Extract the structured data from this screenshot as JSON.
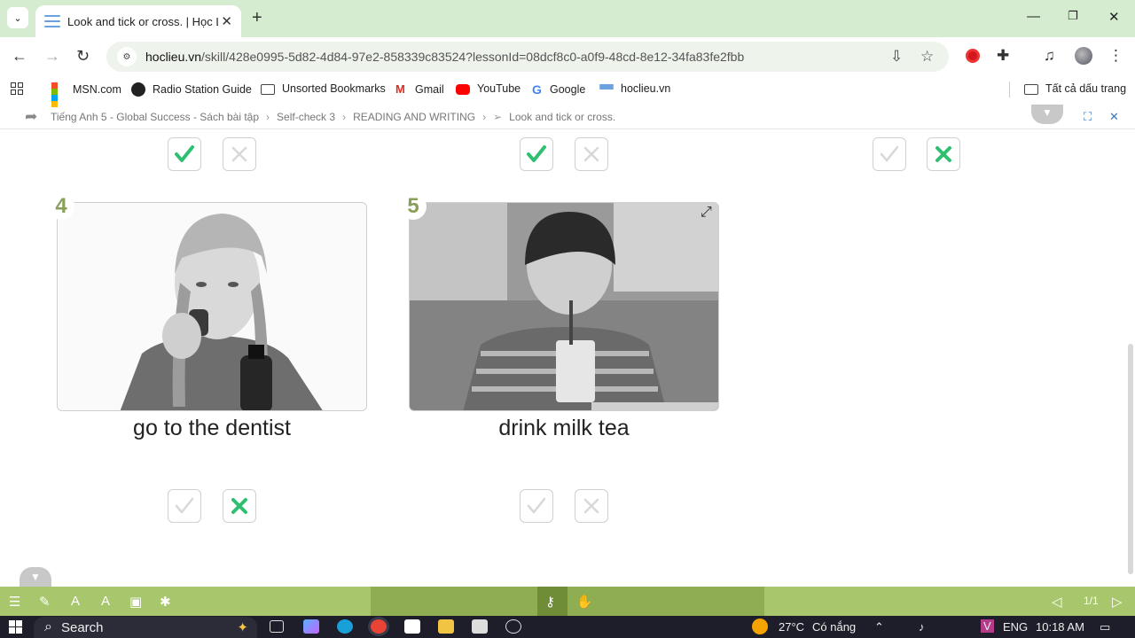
{
  "browser": {
    "tab_title": "Look and tick or cross. | Học Liệ",
    "url_host": "hoclieu.vn",
    "url_path": "/skill/428e0995-5d82-4d84-97e2-858339c83524?lessonId=08dcf8c0-a0f9-48cd-8e12-34fa83fe2fbb"
  },
  "bookmarks": {
    "items": [
      "MSN.com",
      "Radio Station Guide",
      "Unsorted Bookmarks",
      "Gmail",
      "YouTube",
      "Google",
      "hoclieu.vn"
    ],
    "all_bookmarks": "Tất cả dấu trang"
  },
  "breadcrumb": [
    "Tiếng Anh 5 - Global Success - Sách bài tập",
    "Self-check 3",
    "READING AND WRITING",
    "Look and tick or cross."
  ],
  "exercise": {
    "top_row": [
      {
        "tick": "selected",
        "cross": "empty"
      },
      {
        "tick": "selected",
        "cross": "empty"
      },
      {
        "tick": "empty",
        "cross": "selected"
      }
    ],
    "items": [
      {
        "number": "4",
        "caption": "go to the dentist",
        "tick": "empty",
        "cross": "selected"
      },
      {
        "number": "5",
        "caption": "drink milk tea",
        "tick": "empty",
        "cross": "empty"
      }
    ]
  },
  "toolbar": {
    "page": "1/1"
  },
  "taskbar": {
    "search_label": "Search",
    "temperature": "27°C",
    "weather": "Có nắng",
    "language": "ENG",
    "time": "10:18 AM"
  },
  "colors": {
    "accent_green": "#2fbf71",
    "tools_green": "#a8c76c",
    "number_olive": "#8aa05a"
  }
}
